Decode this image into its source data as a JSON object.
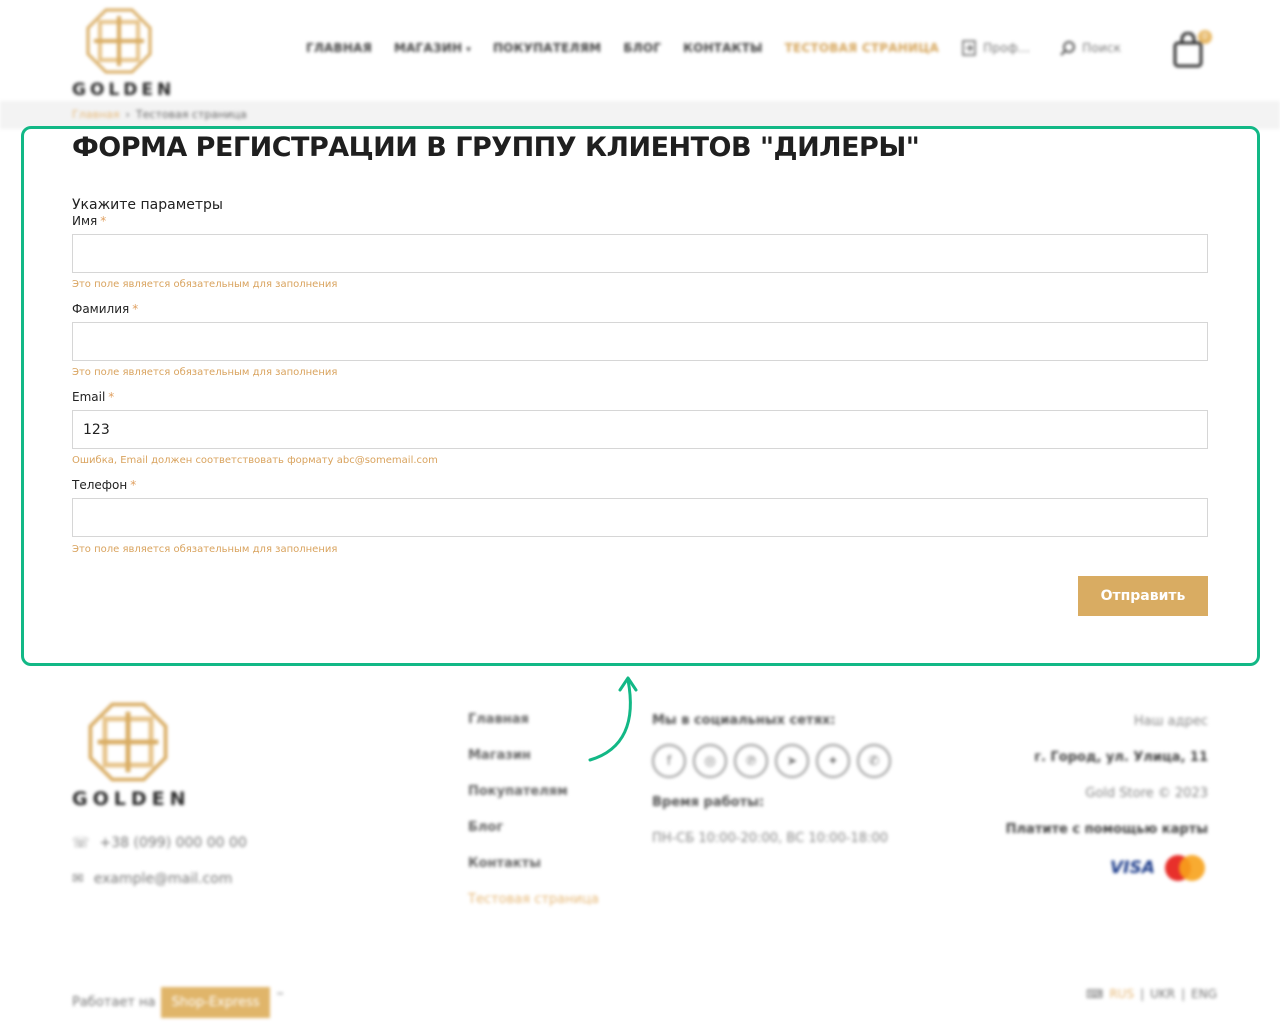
{
  "brand": {
    "name": "GOLDEN",
    "gold": "#d9ac62",
    "accent_green": "#12b886"
  },
  "header": {
    "nav": [
      {
        "label": "ГЛАВНАЯ"
      },
      {
        "label": "МАГАЗИН"
      },
      {
        "label": "ПОКУПАТЕЛЯМ"
      },
      {
        "label": "БЛОГ"
      },
      {
        "label": "КОНТАКТЫ"
      },
      {
        "label": "ТЕСТОВАЯ СТРАНИЦА"
      }
    ],
    "profile_label": "Проф...",
    "search_label": "Поиск",
    "cart_count": "0",
    "icons": {
      "profile": "login-icon",
      "search": "search-icon",
      "cart": "shopping-bag-icon"
    }
  },
  "breadcrumbs": {
    "home": "Главная",
    "current": "Тестовая страница"
  },
  "form": {
    "title": "ФОРМА РЕГИСТРАЦИИ В ГРУППУ КЛИЕНТОВ \"ДИЛЕРЫ\"",
    "subtitle": "Укажите параметры",
    "required_mark": "*",
    "fields": [
      {
        "label": "Имя",
        "value": "",
        "error": "Это поле является обязательным для заполнения"
      },
      {
        "label": "Фамилия",
        "value": "",
        "error": "Это поле является обязательным для заполнения"
      },
      {
        "label": "Email",
        "value": "123",
        "error": "Ошибка, Email должен соответствовать формату abc@somemail.com"
      },
      {
        "label": "Телефон",
        "value": "",
        "error": "Это поле является обязательным для заполнения"
      }
    ],
    "submit_label": "Отправить"
  },
  "footer": {
    "phone": "+38 (099) 000 00 00",
    "email": "example@mail.com",
    "nav": [
      "Главная",
      "Магазин",
      "Покупателям",
      "Блог",
      "Контакты",
      "Тестовая страница"
    ],
    "social_title": "Мы в социальных сетях:",
    "socials": [
      "facebook-icon",
      "instagram-icon",
      "pinterest-icon",
      "telegram-icon",
      "twitter-icon",
      "whatsapp-icon"
    ],
    "work_title": "Время работы:",
    "work_hours": "ПН-СБ 10:00-20:00, ВС 10:00-18:00",
    "address_title": "Наш адрес",
    "address": "г. Город, ул. Улица, 11",
    "copyright": "Gold Store © 2023",
    "pay_title": "Платите с помощью карты",
    "visa": "VISA",
    "powered_prefix": "Работает на",
    "powered_brand": "Shop-Express",
    "powered_tm": "™",
    "langs": [
      "RUS",
      "UKR",
      "ENG"
    ]
  }
}
